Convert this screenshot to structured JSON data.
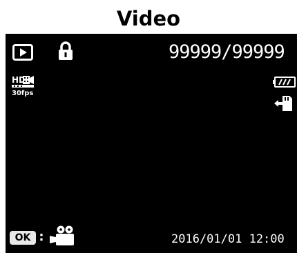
{
  "title": "Video",
  "status": {
    "file_counter": "99999/99999",
    "video_mode_top": "HD",
    "video_mode_fps": "30fps"
  },
  "footer": {
    "ok_key_label": "OK",
    "separator": ":",
    "datetime": "2016/01/01 12:00"
  },
  "icons": {
    "playback": "play-icon",
    "lock": "lock-icon",
    "resolution": "hd-video-icon",
    "battery": "battery-icon",
    "storage": "memory-card-icon",
    "mode": "video-camera-icon"
  }
}
